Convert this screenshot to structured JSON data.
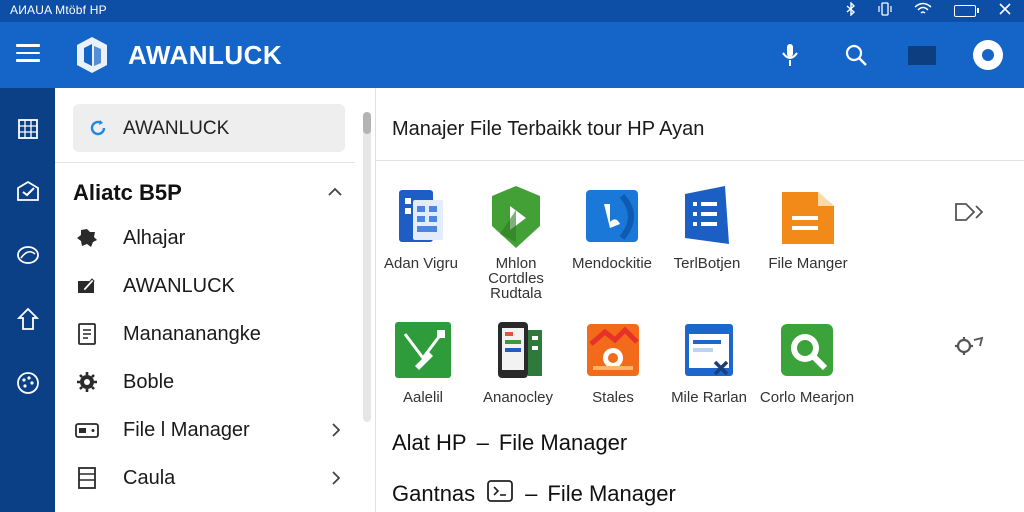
{
  "status_bar": {
    "title": "AИAUA Mtöbf HP",
    "icons": [
      "bluetooth-icon",
      "vibrate-icon",
      "wifi-icon",
      "battery-icon",
      "close-icon"
    ]
  },
  "app_bar": {
    "title": "AWANLUCK",
    "actions": [
      "microphone-icon",
      "search-icon",
      "cast-icon",
      "account-icon"
    ],
    "colors": {
      "primary": "#1565c8",
      "dark": "#0b3f86",
      "status": "#0d4ea6"
    }
  },
  "drawer": {
    "search_value": "AWANLUCK",
    "section_title": "Aliatc B5P",
    "items": [
      {
        "label": "Alhajar",
        "icon": "gear-puzzle-icon",
        "chevron": false
      },
      {
        "label": "AWANLUCK",
        "icon": "edit-folder-icon",
        "chevron": false
      },
      {
        "label": "Manananangke",
        "icon": "document-icon",
        "chevron": false
      },
      {
        "label": "Boble",
        "icon": "settings-icon",
        "chevron": false
      },
      {
        "label": "File l Manager",
        "icon": "drive-icon",
        "chevron": true
      },
      {
        "label": "Caula",
        "icon": "list-icon",
        "chevron": true
      }
    ]
  },
  "rail": {
    "items": [
      "grid-icon",
      "mail-check-icon",
      "disc-icon",
      "home-icon",
      "palette-icon"
    ]
  },
  "main": {
    "title": "Manajer File Terbaikk tour HP Ayan",
    "row1": [
      {
        "label": "Adan Vigru",
        "icon": "docs-app-icon",
        "color": "#1e5cc6"
      },
      {
        "label": "Mhlon Cortdles\nRudtala",
        "icon": "play-app-icon",
        "color": "#43a036"
      },
      {
        "label": "Mendockitie",
        "icon": "bluefile-app-icon",
        "color": "#1a78d8"
      },
      {
        "label": "TerlBotjen",
        "icon": "sheets-app-icon",
        "color": "#1b5fc4"
      },
      {
        "label": "File Manger",
        "icon": "folder-app-icon",
        "color": "#f28a1a"
      }
    ],
    "row2": [
      {
        "label": "Aalelil",
        "icon": "green-edit-app-icon",
        "color": "#2e9c3a"
      },
      {
        "label": "Ananocley",
        "icon": "phone-app-icon",
        "color": "#2d7a3a"
      },
      {
        "label": "Stales",
        "icon": "orange-photo-app-icon",
        "color": "#f26a1a"
      },
      {
        "label": "Mile Rarlan",
        "icon": "window-app-icon",
        "color": "#1d67cc"
      },
      {
        "label": "Corlo Mearjon",
        "icon": "search-app-icon",
        "color": "#3ba33a"
      }
    ],
    "row_actions": [
      "send-arrow-icon",
      "share-gear-icon"
    ],
    "list": [
      {
        "left": "Alat HP",
        "sep": "–",
        "right": "File Manager",
        "icon": ""
      },
      {
        "left": "Gantnas",
        "sep": "–",
        "right": "File Manager",
        "icon": "terminal-icon"
      }
    ]
  }
}
